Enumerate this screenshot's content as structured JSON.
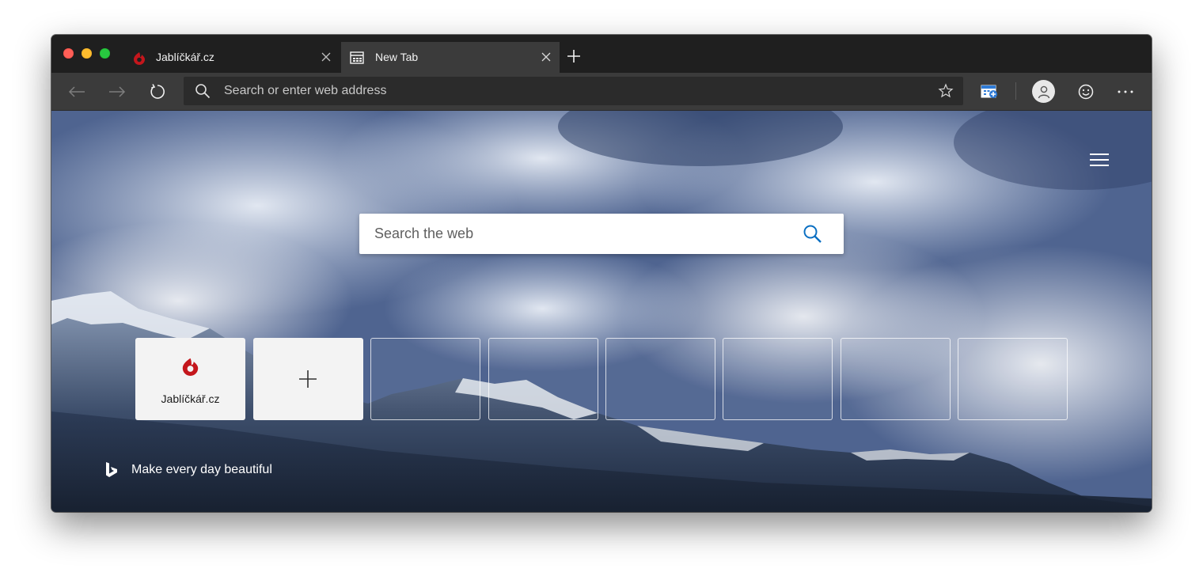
{
  "window": {
    "traffic_lights": [
      "close",
      "minimize",
      "zoom"
    ]
  },
  "tabs": [
    {
      "title": "Jablíčkář.cz",
      "favicon": "jablickar-logo-icon",
      "active": false
    },
    {
      "title": "New Tab",
      "favicon": "newtab-page-icon",
      "active": true
    }
  ],
  "toolbar": {
    "address_placeholder": "Search or enter web address",
    "icons": [
      "back-arrow-icon",
      "forward-arrow-icon",
      "refresh-icon",
      "search-icon",
      "star-icon",
      "collections-icon",
      "profile-avatar-icon",
      "smiley-feedback-icon",
      "more-ellipsis-icon"
    ]
  },
  "newtab": {
    "search_placeholder": "Search the web",
    "top_sites": [
      {
        "label": "Jablíčkář.cz",
        "type": "site"
      },
      {
        "label": "",
        "type": "add"
      },
      {
        "label": "",
        "type": "empty"
      },
      {
        "label": "",
        "type": "empty"
      },
      {
        "label": "",
        "type": "empty"
      },
      {
        "label": "",
        "type": "empty"
      },
      {
        "label": "",
        "type": "empty"
      },
      {
        "label": "",
        "type": "empty"
      }
    ],
    "bing_caption": "Make every day beautiful"
  },
  "colors": {
    "chrome_dark": "#1f1f1f",
    "toolbar": "#3b3b3b",
    "address_bar": "#2b2b2b",
    "jablickar_red": "#c4161c",
    "accent_blue": "#0a6fc2"
  }
}
